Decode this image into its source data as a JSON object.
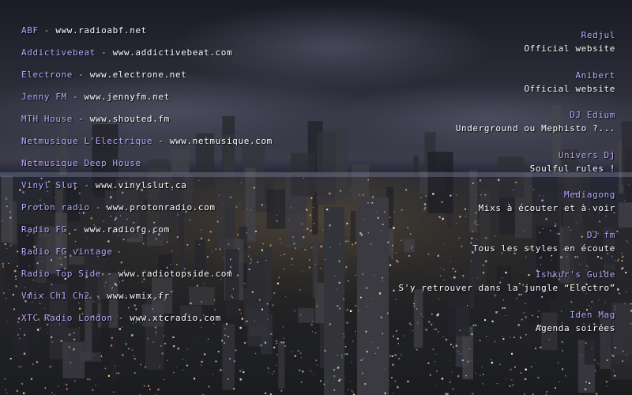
{
  "colors": {
    "link_name": "#b8aaff",
    "url_text": "#ffffff",
    "sky_top": "#1f2029",
    "city_glow": "#c8b48a"
  },
  "background": {
    "description_icon": "night-city-skyline-photo"
  },
  "left_links": [
    {
      "name": "ABF",
      "sep": " - ",
      "url": "www.radioabf.net"
    },
    {
      "name": "Addictivebeat",
      "sep": " - ",
      "url": "www.addictivebeat.com"
    },
    {
      "name": "Electrone",
      "sep": " - ",
      "url": "www.electrone.net"
    },
    {
      "name": "Jenny FM",
      "sep": " - ",
      "url": "www.jennyfm.net"
    },
    {
      "name": "MTH House",
      "sep": " - ",
      "url": "www.shouted.fm"
    },
    {
      "name": "Netmusique L'Electrique",
      "sep": " - ",
      "url": "www.netmusique.com"
    },
    {
      "name": "Netmusique Deep House",
      "sep": "",
      "url": ""
    },
    {
      "name": "Vinyl Slut",
      "sep": " - ",
      "url": "www.vinylslut.ca"
    },
    {
      "name": "Proton radio",
      "sep": " - ",
      "url": "www.protonradio.com"
    },
    {
      "name": "Radio FG",
      "sep": " - ",
      "url": "www.radiofg.com"
    },
    {
      "name": "Radio FG vintage",
      "sep": "",
      "url": ""
    },
    {
      "name": "Radio Top Side",
      "sep": " - ",
      "url": "www.radiotopside.com"
    },
    {
      "name": "Vmix Ch1 Ch2",
      "sep": " - ",
      "url": "www.wmix.fr"
    },
    {
      "name": "XTC Radio London",
      "sep": " - ",
      "url": "www.xtcradio.com"
    }
  ],
  "right_links": [
    {
      "title": "Redjul",
      "desc": "Official website"
    },
    {
      "title": "Anibert",
      "desc": "Official website"
    },
    {
      "title": "DJ Edium",
      "desc": "Underground ou Mephisto ?..."
    },
    {
      "title": "Univers Dj",
      "desc": "Soulful rules !"
    },
    {
      "title": "Mediagong",
      "desc": "Mixs à écouter et à voir"
    },
    {
      "title": "DJ fm",
      "desc": "Tous les styles en écoute"
    },
    {
      "title": "Ishkur's Guide",
      "desc": "S'y retrouver dans la jungle “Electro”"
    },
    {
      "title": "Iden Mag",
      "desc": "Agenda soirées"
    }
  ]
}
